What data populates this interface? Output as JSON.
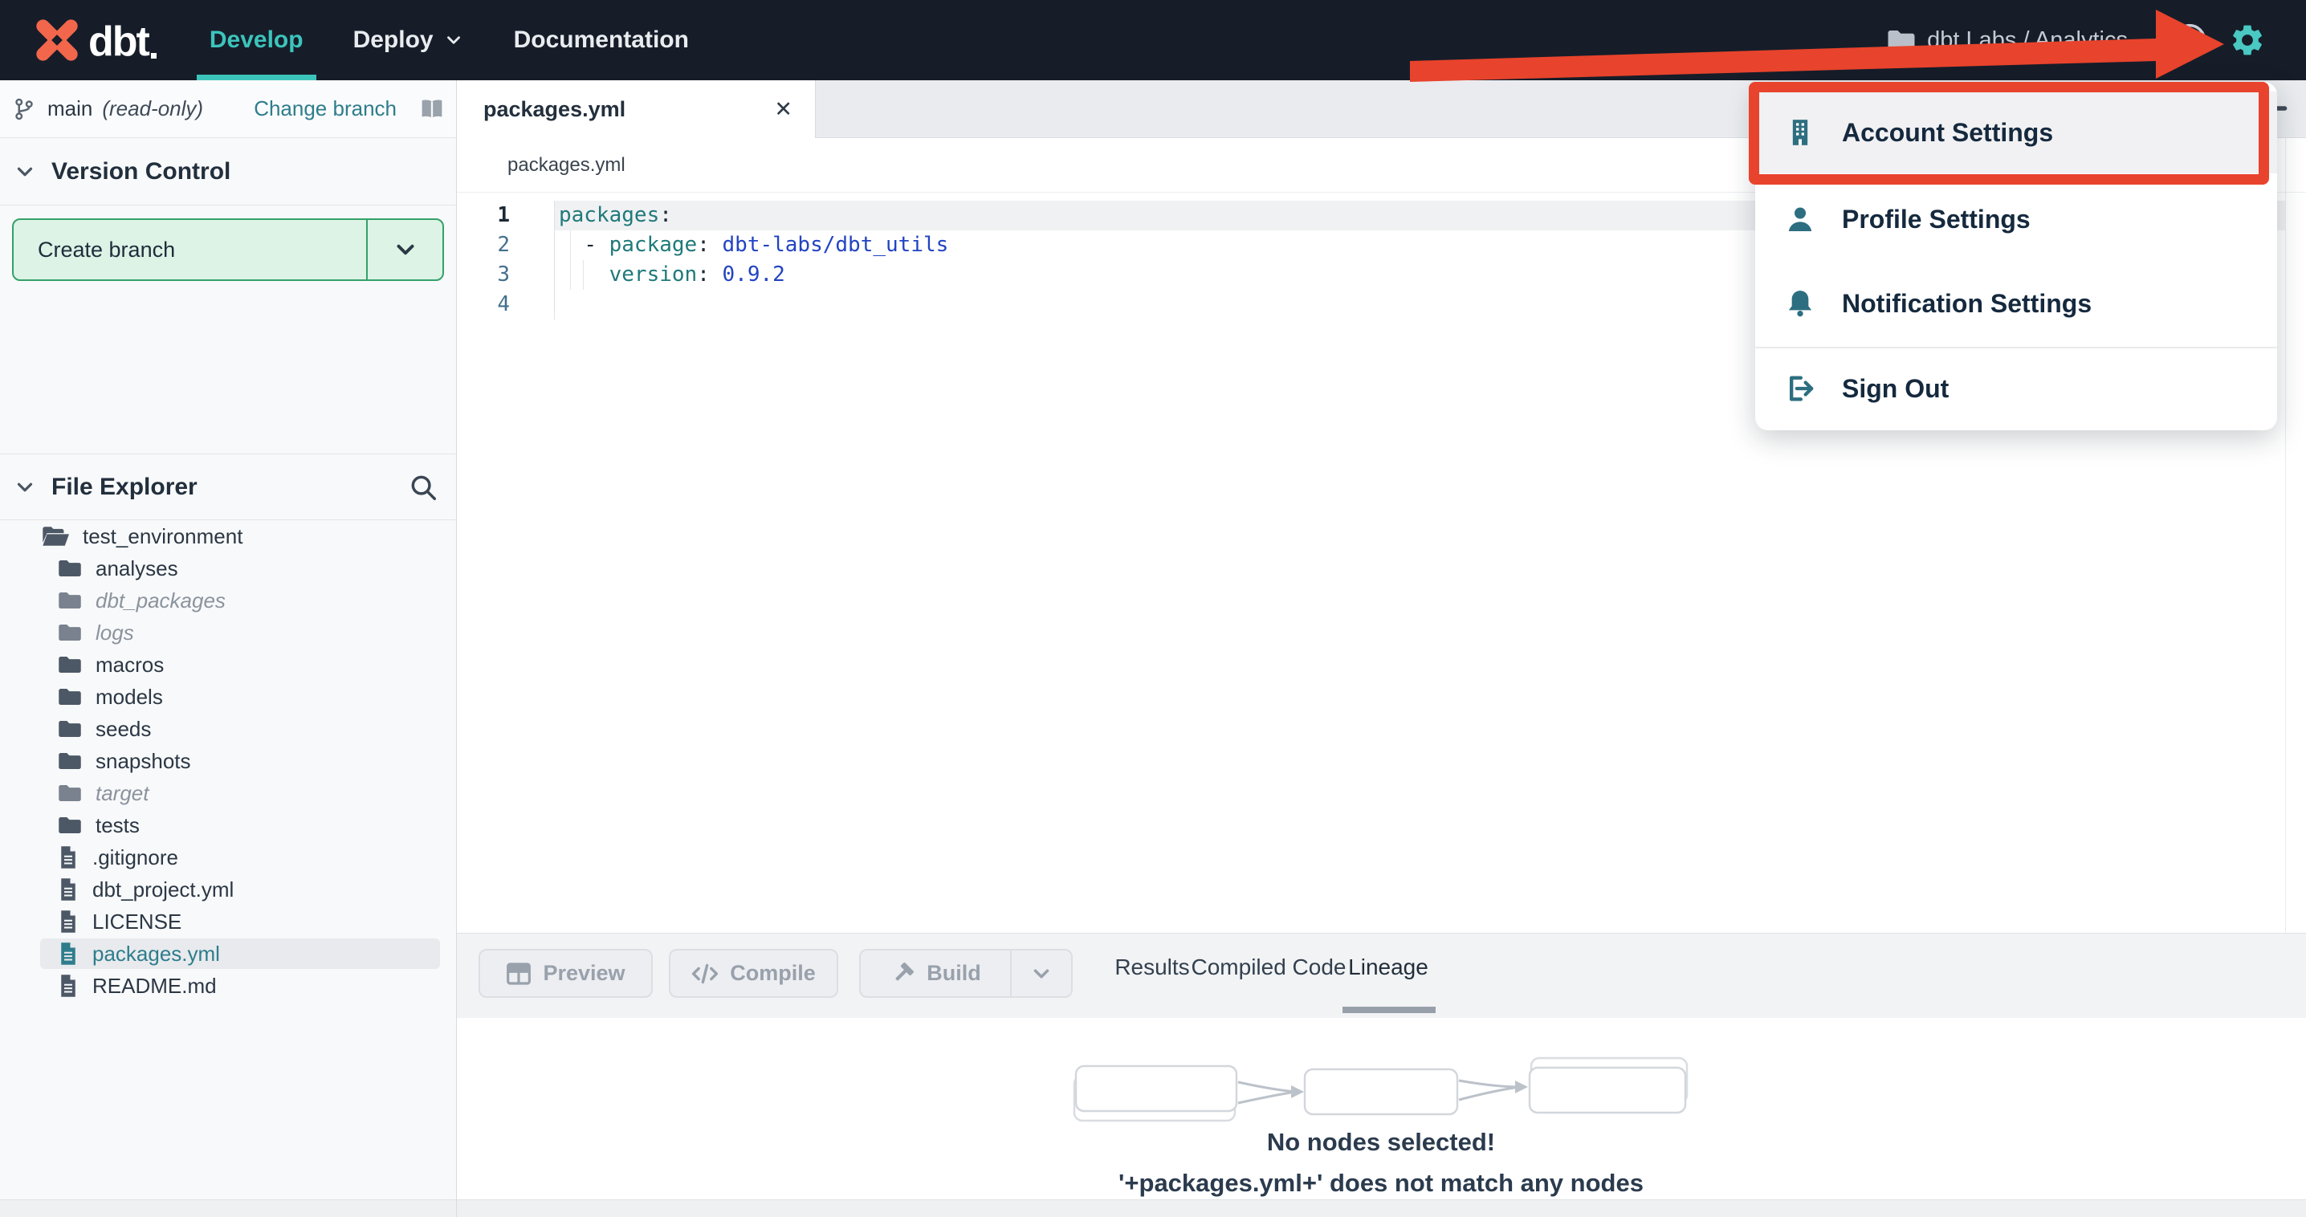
{
  "colors": {
    "navbar_bg": "#161d29",
    "accent_teal": "#3cc4bb",
    "gear_teal": "#49c9c2",
    "menu_icon_teal": "#2d6e80",
    "annotation_red": "#e8432c",
    "brand_orange": "#f2664c",
    "create_branch_green": "#35a169",
    "selected_file_teal": "#2e7d8c",
    "code_key_teal": "#20797a",
    "code_value_blue": "#2243c1"
  },
  "icons": {
    "close_tab_glyph": "✕",
    "names": [
      "dbt-logo",
      "chevron-down-icon",
      "folder-icon",
      "folder-open-icon",
      "file-icon",
      "git-branch-icon",
      "book-icon",
      "search-icon",
      "gear-icon",
      "user-avatar-icon",
      "building-icon",
      "user-icon",
      "bell-icon",
      "sign-out-icon",
      "plus-icon",
      "close-icon",
      "preview-grid-icon",
      "code-icon",
      "hammer-icon"
    ]
  },
  "navbar": {
    "brand": "dbt",
    "nav_items": [
      {
        "label": "Develop"
      },
      {
        "label": "Deploy"
      },
      {
        "label": "Documentation"
      }
    ],
    "account_label": "dbt Labs / Analytics"
  },
  "account_menu": {
    "items": [
      {
        "label": "Account Settings",
        "icon": "building-icon",
        "highlighted": true
      },
      {
        "label": "Profile Settings",
        "icon": "user-icon"
      },
      {
        "label": "Notification Settings",
        "icon": "bell-icon"
      },
      {
        "label": "Sign Out",
        "icon": "sign-out-icon"
      }
    ]
  },
  "version_control": {
    "branch_name": "main",
    "branch_mode": "(read-only)",
    "change_branch_label": "Change branch",
    "section_title": "Version Control",
    "create_branch_label": "Create branch"
  },
  "file_explorer": {
    "section_title": "File Explorer",
    "root_folder": "test_environment",
    "entries": [
      {
        "label": "analyses",
        "type": "folder"
      },
      {
        "label": "dbt_packages",
        "type": "folder",
        "muted": true
      },
      {
        "label": "logs",
        "type": "folder",
        "muted": true
      },
      {
        "label": "macros",
        "type": "folder"
      },
      {
        "label": "models",
        "type": "folder"
      },
      {
        "label": "seeds",
        "type": "folder"
      },
      {
        "label": "snapshots",
        "type": "folder"
      },
      {
        "label": "target",
        "type": "folder",
        "muted": true
      },
      {
        "label": "tests",
        "type": "folder"
      },
      {
        "label": ".gitignore",
        "type": "file"
      },
      {
        "label": "dbt_project.yml",
        "type": "file"
      },
      {
        "label": "LICENSE",
        "type": "file"
      },
      {
        "label": "packages.yml",
        "type": "file",
        "selected": true
      },
      {
        "label": "README.md",
        "type": "file"
      }
    ]
  },
  "editor": {
    "tab_title": "packages.yml",
    "breadcrumb": "packages.yml",
    "line_numbers": [
      "1",
      "2",
      "3",
      "4"
    ],
    "code_lines": [
      {
        "number": "1",
        "tokens": {
          "key": "packages",
          "punct": ":"
        }
      },
      {
        "number": "2",
        "tokens": {
          "ws": "  ",
          "punct": "- ",
          "key": "package",
          "sep": ": ",
          "value": "dbt-labs/dbt_utils"
        }
      },
      {
        "number": "3",
        "tokens": {
          "ws": "    ",
          "key": "version",
          "sep": ": ",
          "value": "0.9.2"
        }
      },
      {
        "number": "4",
        "tokens": {}
      }
    ]
  },
  "action_bar": {
    "preview_label": "Preview",
    "compile_label": "Compile",
    "build_label": "Build"
  },
  "result_tabs": [
    {
      "label": "Results"
    },
    {
      "label": "Compiled Code"
    },
    {
      "label": "Lineage",
      "active": true
    }
  ],
  "lineage": {
    "empty_title": "No nodes selected!",
    "empty_message": "'+packages.yml+' does not match any nodes"
  }
}
